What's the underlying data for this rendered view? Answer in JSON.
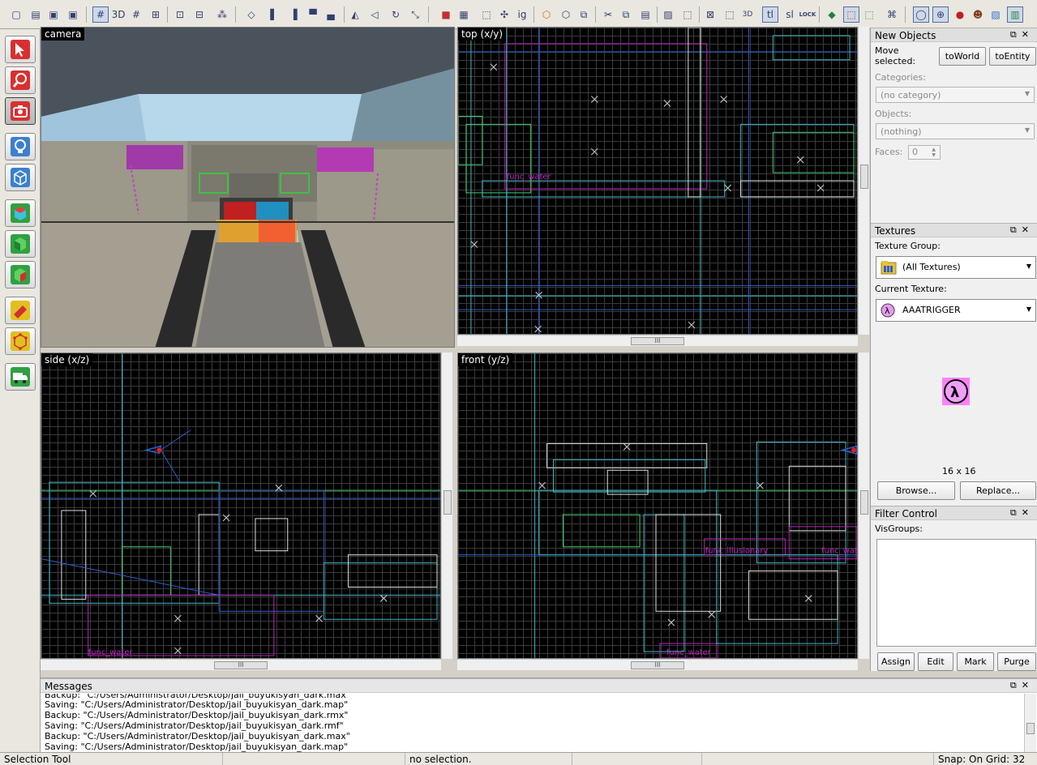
{
  "toolbar": {
    "icons": [
      "new-file-icon",
      "open-file-icon",
      "save-icon",
      "save-as-icon",
      "grid-icon",
      "3d-grid-icon",
      "grid-small-icon",
      "grid-large-icon",
      "group-icon",
      "ungroup-icon",
      "hide-icon",
      "carve-icon",
      "align-left-icon",
      "align-right-icon",
      "align-top-icon",
      "align-bottom-icon",
      "flip-h-icon",
      "flip-v-icon",
      "rotate-icon",
      "scale-icon",
      "run-map-icon",
      "entity-report-icon",
      "check-problems-icon",
      "ignore-groups-icon",
      "texture-lock-icon",
      "texture-app-icon",
      "cut-icon",
      "copy-icon",
      "paste-icon",
      "carve-tool-icon",
      "hollow-icon",
      "tie-to-entity-icon",
      "selection-only-icon",
      "3d-view-icon",
      "toggle-texture-lock-icon",
      "sl-icon",
      "lock-icon",
      "paint-icon",
      "texture-browser-icon",
      "decal-icon",
      "model-icon",
      "camera-shade-icon",
      "help-icon",
      "color-icon",
      "user-icon",
      "portal-icon"
    ],
    "text_buttons": {
      "ig": "ig",
      "tl": "tl",
      "sl": "sl",
      "lock": "LOCK",
      "threed": "3D"
    }
  },
  "left_tools": [
    "selection-tool",
    "magnify-tool",
    "camera-tool",
    "entity-tool",
    "block-tool",
    "texture-application-tool",
    "apply-decals-tool",
    "overlay-tool",
    "clipping-tool",
    "vertex-manipulation-tool",
    "path-tool"
  ],
  "viewports": {
    "camera": {
      "label": "camera"
    },
    "top": {
      "label": "top (x/y)",
      "entity_label": "func_water"
    },
    "side": {
      "label": "side (x/z)",
      "entity_label": "func_water"
    },
    "front": {
      "label": "front (y/z)",
      "entity_labels": [
        "func_water",
        "func_illusionary",
        "func_water"
      ]
    }
  },
  "new_objects": {
    "title": "New Objects",
    "move_selected": "Move\nselected:",
    "to_world": "toWorld",
    "to_entity": "toEntity",
    "categories_label": "Categories:",
    "categories_value": "(no category)",
    "objects_label": "Objects:",
    "objects_value": "(nothing)",
    "faces_label": "Faces:",
    "faces_value": "0"
  },
  "textures": {
    "title": "Textures",
    "group_label": "Texture Group:",
    "group_value": "(All Textures)",
    "current_label": "Current Texture:",
    "current_value": "AAATRIGGER",
    "size": "16 x 16",
    "browse": "Browse...",
    "replace": "Replace..."
  },
  "filter_control": {
    "title": "Filter Control",
    "visgroups_label": "VisGroups:",
    "assign": "Assign",
    "edit": "Edit",
    "mark": "Mark",
    "purge": "Purge"
  },
  "messages": {
    "title": "Messages",
    "lines": [
      "Backup: \"C:/Users/Administrator/Desktop/jail_buyukisyan_dark.max\"",
      "Saving: \"C:/Users/Administrator/Desktop/jail_buyukisyan_dark.map\"",
      "Backup: \"C:/Users/Administrator/Desktop/jail_buyukisyan_dark.rmx\"",
      "Saving: \"C:/Users/Administrator/Desktop/jail_buyukisyan_dark.rmf\"",
      "Backup: \"C:/Users/Administrator/Desktop/jail_buyukisyan_dark.max\"",
      "Saving: \"C:/Users/Administrator/Desktop/jail_buyukisyan_dark.map\""
    ]
  },
  "status_bar": {
    "tool": "Selection Tool",
    "selection": "no selection.",
    "snap": "Snap: On Grid: 32"
  },
  "colors": {
    "brush_cyan": "#3fb8c8",
    "brush_blue": "#2f5fd0",
    "brush_green": "#40d070",
    "entity_magenta": "#c020c0",
    "grid": "#3b3b3b"
  }
}
